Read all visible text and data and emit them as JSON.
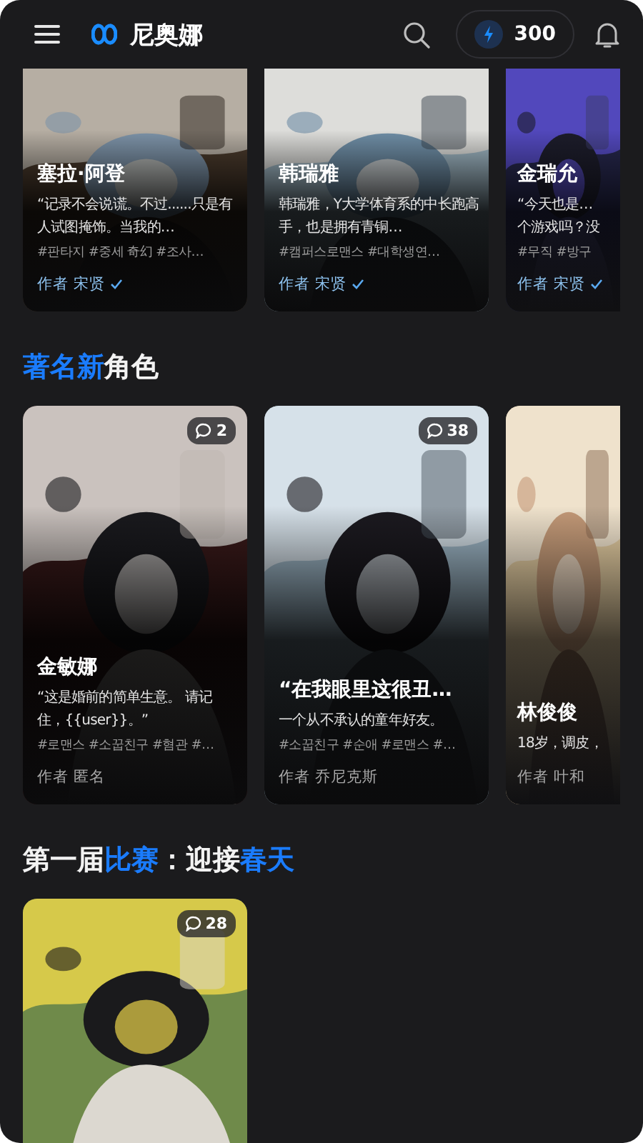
{
  "header": {
    "logo": "尼奥娜",
    "credits": "300"
  },
  "sections": [
    {
      "cards": [
        {
          "name": "塞拉·阿登",
          "description": "“记录不会说谎。不过......只是有人试图掩饰。当我的…",
          "tags": "#판타지 #중세 奇幻 #조사…",
          "author": "作者 宋贤",
          "verified": true,
          "partial": false
        },
        {
          "name": "韩瑞雅",
          "description": "韩瑞雅，Y大学体育系的中长跑高手，也是拥有青铜…",
          "tags": "#캠퍼스로맨스 #대학생연…",
          "author": "作者 宋贤",
          "verified": true,
          "partial": false
        },
        {
          "name": "金瑞允",
          "description": "“今天也是…\n个游戏吗？没",
          "tags": "#무직 #방구",
          "author": "作者 宋贤",
          "verified": true,
          "partial": true
        }
      ]
    },
    {
      "title": [
        {
          "text": "著名新",
          "highlight": true
        },
        {
          "text": "角色",
          "highlight": false
        }
      ],
      "cards": [
        {
          "comments": "2",
          "name": "金敏娜",
          "description": "“这是婚前的简单生意。 请记住，{{user}}。”",
          "tags": "#로맨스 #소꿉친구 #혐관 #…",
          "author": "作者 匿名",
          "verified": false,
          "partial": false
        },
        {
          "comments": "38",
          "name": "“在我眼里这很丑…",
          "description": "一个从不承认的童年好友。",
          "tags": "#소꿉친구 #순애 #로맨스 #…",
          "author": "作者 乔尼克斯",
          "verified": false,
          "partial": false
        },
        {
          "name": "林俊俊",
          "description": "18岁，调皮，",
          "author": "作者 叶和",
          "verified": false,
          "partial": true
        }
      ]
    },
    {
      "title": [
        {
          "text": "第一届",
          "highlight": false
        },
        {
          "text": "比赛",
          "highlight": true
        },
        {
          "text": "：迎接",
          "highlight": false
        },
        {
          "text": "春天",
          "highlight": true
        }
      ],
      "cards": [
        {
          "comments": "28",
          "partial": false,
          "kind": "picture"
        }
      ]
    }
  ]
}
